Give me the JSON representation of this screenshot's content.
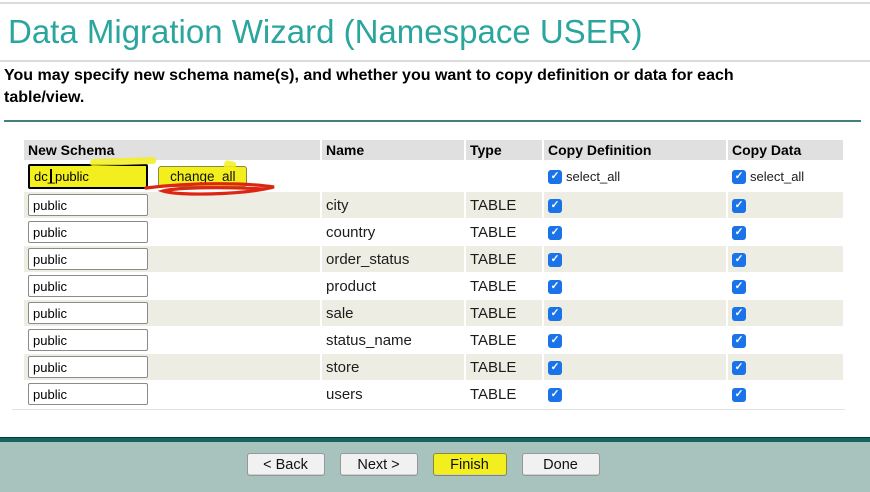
{
  "title": "Data Migration Wizard (Namespace USER)",
  "subtitle": "You may specify new schema name(s), and whether you want to copy definition or data for each table/view.",
  "table": {
    "headers": [
      "New Schema",
      "Name",
      "Type",
      "Copy Definition",
      "Copy Data"
    ],
    "first_row": {
      "schema_input_value": "dc_public",
      "change_all_label": "change_all",
      "copy_definition_select_all_label": "select_all",
      "copy_data_select_all_label": "select_all",
      "copy_definition_checked": true,
      "copy_data_checked": true
    },
    "rows": [
      {
        "schema": "public",
        "name": "city",
        "type": "TABLE",
        "copy_definition": true,
        "copy_data": true
      },
      {
        "schema": "public",
        "name": "country",
        "type": "TABLE",
        "copy_definition": true,
        "copy_data": true
      },
      {
        "schema": "public",
        "name": "order_status",
        "type": "TABLE",
        "copy_definition": true,
        "copy_data": true
      },
      {
        "schema": "public",
        "name": "product",
        "type": "TABLE",
        "copy_definition": true,
        "copy_data": true
      },
      {
        "schema": "public",
        "name": "sale",
        "type": "TABLE",
        "copy_definition": true,
        "copy_data": true
      },
      {
        "schema": "public",
        "name": "status_name",
        "type": "TABLE",
        "copy_definition": true,
        "copy_data": true
      },
      {
        "schema": "public",
        "name": "store",
        "type": "TABLE",
        "copy_definition": true,
        "copy_data": true
      },
      {
        "schema": "public",
        "name": "users",
        "type": "TABLE",
        "copy_definition": true,
        "copy_data": true
      }
    ]
  },
  "footer": {
    "buttons": [
      {
        "label": "< Back"
      },
      {
        "label": "Next >"
      },
      {
        "label": "Finish",
        "highlighted": true
      },
      {
        "label": "Done"
      }
    ]
  },
  "colors": {
    "accent_teal": "#2aa69e",
    "rule_teal": "#41807c",
    "header_cell_bg": "#e0e0e0",
    "alt_row_bg": "#ededE3",
    "checkbox_blue": "#1a73e8",
    "marker_yellow": "#f3ee1d",
    "annotation_red": "#dd2612",
    "footer_bar": "#0e6868",
    "footer_bg": "#a8c2be"
  }
}
